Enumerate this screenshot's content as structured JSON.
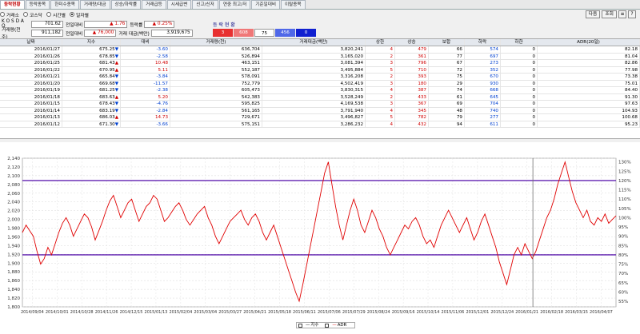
{
  "tabs": [
    "등락현황",
    "등락종목",
    "한미수종목",
    "거래량/대금",
    "상승/하락률",
    "거래급등",
    "시세급변",
    "신고/신저",
    "연중 최고/저",
    "기준일대비",
    "이탈종목"
  ],
  "radios": [
    {
      "label": "거래소",
      "checked": false
    },
    {
      "label": "코스닥",
      "checked": false
    },
    {
      "label": "시간별",
      "checked": false
    },
    {
      "label": "일자별",
      "checked": true
    }
  ],
  "buttons": {
    "next": "다음",
    "query": "조회"
  },
  "info": {
    "row1": {
      "label": "K O S D A Q",
      "value": "701.62",
      "change_label": "전일대비",
      "change": "▲ 1.76",
      "rate_label": "등락률",
      "rate": "▲ 0.25%"
    },
    "row2": {
      "label": "거래량(천주)",
      "value": "911,182",
      "change_label": "전일대비",
      "change": "▲ 76,000",
      "amount_label": "거래 대금(백만)",
      "amount": "3,919,675"
    }
  },
  "status": {
    "title": "등 락 현 황",
    "boxes": [
      {
        "value": "3",
        "color": "#e83030"
      },
      {
        "value": "608",
        "color": "#f07878"
      },
      {
        "value": "75",
        "color": "#ffffff"
      },
      {
        "value": "456",
        "color": "#5068e8"
      },
      {
        "value": "0",
        "color": "#1020d0"
      }
    ]
  },
  "table": {
    "headers": [
      "날짜",
      "지수",
      "대비",
      "거래량(천)",
      "거래대금(백만)",
      "상한",
      "상승",
      "보합",
      "하락",
      "하한",
      "ADR(20일)"
    ],
    "rows": [
      [
        "2016/01/27",
        "675.25",
        "▼",
        "-3.60",
        "636,704",
        "3,820,241",
        "4",
        "479",
        "66",
        "574",
        "0",
        "82.18"
      ],
      [
        "2016/01/26",
        "678.85",
        "▼",
        "-2.58",
        "526,894",
        "3,165,020",
        "2",
        "361",
        "77",
        "697",
        "0",
        "81.04"
      ],
      [
        "2016/01/25",
        "681.43",
        "▲",
        "10.48",
        "463,151",
        "3,081,394",
        "3",
        "796",
        "67",
        "273",
        "0",
        "82.86"
      ],
      [
        "2016/01/22",
        "670.95",
        "▲",
        "5.11",
        "552,187",
        "3,495,884",
        "5",
        "710",
        "72",
        "352",
        "0",
        "77.98"
      ],
      [
        "2016/01/21",
        "665.84",
        "▼",
        "-3.84",
        "578,091",
        "3,316,208",
        "2",
        "393",
        "75",
        "670",
        "0",
        "73.38"
      ],
      [
        "2016/01/20",
        "669.68",
        "▼",
        "-11.57",
        "752,779",
        "4,502,419",
        "3",
        "180",
        "29",
        "930",
        "0",
        "75.01"
      ],
      [
        "2016/01/19",
        "681.25",
        "▼",
        "-2.38",
        "605,473",
        "3,830,315",
        "4",
        "387",
        "74",
        "668",
        "0",
        "84.40"
      ],
      [
        "2016/01/18",
        "683.63",
        "▲",
        "5.20",
        "542,383",
        "3,528,249",
        "2",
        "433",
        "61",
        "645",
        "0",
        "91.30"
      ],
      [
        "2016/01/15",
        "678.43",
        "▼",
        "-4.76",
        "595,825",
        "4,169,538",
        "3",
        "367",
        "69",
        "704",
        "0",
        "97.63"
      ],
      [
        "2016/01/14",
        "683.19",
        "▼",
        "-2.84",
        "561,165",
        "3,791,940",
        "4",
        "345",
        "48",
        "740",
        "0",
        "104.93"
      ],
      [
        "2016/01/13",
        "686.03",
        "▲",
        "14.73",
        "729,671",
        "3,496,827",
        "5",
        "782",
        "79",
        "277",
        "0",
        "100.68"
      ],
      [
        "2016/01/12",
        "671.30",
        "▼",
        "-3.66",
        "575,151",
        "3,286,232",
        "4",
        "432",
        "94",
        "611",
        "0",
        "95.23"
      ]
    ]
  },
  "chart_data": {
    "type": "line",
    "left_axis": {
      "ticks": [
        "2,140",
        "2,120",
        "2,100",
        "2,080",
        "2,060",
        "2,040",
        "2,020",
        "2,000",
        "1,980",
        "1,960",
        "1,940",
        "1,920",
        "1,900",
        "1,880",
        "1,860",
        "1,840",
        "1,820",
        "1,800"
      ],
      "ylim": [
        1800,
        2140
      ]
    },
    "right_axis": {
      "ticks": [
        "130%",
        "125%",
        "120%",
        "115%",
        "110%",
        "105%",
        "100%",
        "95%",
        "90%",
        "85%",
        "80%",
        "75%",
        "70%",
        "65%",
        "60%",
        "55%"
      ],
      "ylim": [
        52,
        132
      ]
    },
    "x_ticks": [
      "2014/09/04",
      "2014/10/01",
      "2014/10/28",
      "2014/11/26",
      "2014/12/15",
      "2015/01/13",
      "2015/02/04",
      "2015/03/04",
      "2015/03/27",
      "2015/04/21",
      "2015/05/18",
      "2015/06/11",
      "2015/07/06",
      "2015/07/29",
      "2015/08/24",
      "2015/09/16",
      "2015/10/14",
      "2015/11/06",
      "2015/12/01",
      "2015/12/24",
      "2016/01/21",
      "2016/02/18",
      "2016/03/15",
      "2016/04/07"
    ],
    "reference_lines": [
      120,
      80
    ],
    "series": [
      {
        "name": "지수",
        "values": []
      },
      {
        "name": "ADR",
        "axis": "right",
        "values": [
          92,
          96,
          93,
          90,
          82,
          75,
          78,
          84,
          80,
          86,
          92,
          97,
          100,
          96,
          90,
          94,
          98,
          102,
          100,
          95,
          88,
          93,
          98,
          104,
          109,
          112,
          106,
          100,
          104,
          108,
          110,
          104,
          98,
          102,
          106,
          108,
          112,
          110,
          104,
          98,
          100,
          103,
          106,
          108,
          104,
          99,
          96,
          99,
          102,
          104,
          106,
          100,
          96,
          90,
          86,
          90,
          94,
          98,
          100,
          102,
          104,
          99,
          96,
          100,
          102,
          98,
          92,
          88,
          92,
          96,
          90,
          84,
          78,
          72,
          66,
          60,
          55,
          64,
          74,
          84,
          94,
          104,
          114,
          124,
          130,
          118,
          106,
          96,
          88,
          96,
          104,
          110,
          104,
          96,
          92,
          98,
          104,
          100,
          94,
          90,
          84,
          80,
          84,
          88,
          92,
          96,
          94,
          98,
          100,
          96,
          90,
          86,
          88,
          84,
          90,
          96,
          100,
          104,
          100,
          96,
          92,
          96,
          100,
          94,
          88,
          92,
          98,
          102,
          96,
          90,
          84,
          76,
          70,
          64,
          72,
          80,
          84,
          80,
          86,
          82,
          78,
          82,
          88,
          94,
          100,
          104,
          110,
          118,
          124,
          130,
          122,
          114,
          108,
          104,
          100,
          104,
          98,
          96,
          100,
          98,
          102,
          97,
          99,
          101
        ]
      }
    ],
    "cursor_date": "2016/01/21"
  },
  "legend": [
    {
      "label": "지수",
      "color": "#000000"
    },
    {
      "label": "ADR",
      "color": "#e00000"
    }
  ]
}
